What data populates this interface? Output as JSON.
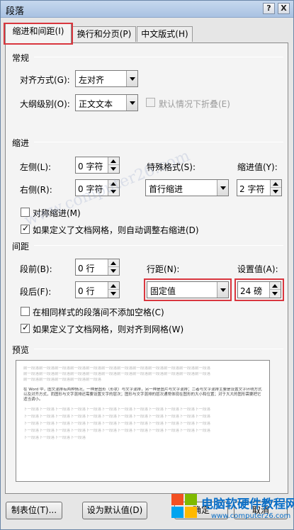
{
  "window": {
    "title": "段落"
  },
  "titlebar": {
    "help": "?",
    "close": "X"
  },
  "tabs": [
    {
      "label": "缩进和间距(I)",
      "key": "I"
    },
    {
      "label": "换行和分页(P)",
      "key": "P"
    },
    {
      "label": "中文版式(H)",
      "key": "H"
    }
  ],
  "general": {
    "header": "常规",
    "alignment": {
      "label": "对齐方式(G):",
      "value": "左对齐"
    },
    "outline": {
      "label": "大纲级别(O):",
      "value": "正文文本"
    },
    "collapsed": {
      "label": "默认情况下折叠(E)",
      "checked": false,
      "disabled": true
    }
  },
  "indent": {
    "header": "缩进",
    "left": {
      "label": "左侧(L):",
      "value": "0 字符"
    },
    "right": {
      "label": "右侧(R):",
      "value": "0 字符"
    },
    "special": {
      "label": "特殊格式(S):",
      "value": "首行缩进"
    },
    "by": {
      "label": "缩进值(Y):",
      "value": "2 字符"
    },
    "mirror": {
      "label": "对称缩进(M)",
      "checked": false
    },
    "auto_adjust": {
      "label": "如果定义了文档网格，则自动调整右缩进(D)",
      "checked": true
    }
  },
  "spacing": {
    "header": "间距",
    "before": {
      "label": "段前(B):",
      "value": "0 行"
    },
    "after": {
      "label": "段后(F):",
      "value": "0 行"
    },
    "line_spacing": {
      "label": "行距(N):",
      "value": "固定值"
    },
    "at": {
      "label": "设置值(A):",
      "value": "24 磅"
    },
    "no_space_same_style": {
      "label": "在相同样式的段落间不添加空格(C)",
      "checked": false
    },
    "snap_grid": {
      "label": "如果定义了文档网格，则对齐到网格(W)",
      "checked": true
    }
  },
  "preview": {
    "header": "预览",
    "prev_lines": [
      "前一段落前一段落前一段落前一段落前一段落前一段落前一段落前一段落前一段落前一段落前一段落前一段落",
      "前一段落前一段落前一段落前一段落前一段落前一段落前一段落前一段落前一段落前一段落前一段落前一段落",
      "前一段落前一段落前一段落前一段落前一段落"
    ],
    "current_lines": [
      "在 Word 中，图文混排有两种情况，一种是图形（形状）与文字混排，另一种是图片与文字混排；二者与文字混排主要是设置文字环绕方式以及对齐方式，而图形与文字混排还需要设置文字的层次；图形与文字混排的层次通常体现在图形的大小和位置；对于大大的图形需要把它适当调小。"
    ],
    "next_lines": [
      "下一段落下一段落下一段落下一段落下一段落下一段落下一段落下一段落下一段落下一段落下一段落下一段落",
      "下一段落下一段落下一段落下一段落下一段落下一段落下一段落下一段落下一段落下一段落下一段落下一段落",
      "下一段落下一段落下一段落下一段落下一段落下一段落下一段落下一段落下一段落下一段落下一段落下一段落",
      "下一段落下一段落下一段落下一段落下一段落下一段落下一段落下一段落下一段落下一段落下一段落下一段落",
      "下一段落下一段落下一段落下一段落"
    ]
  },
  "buttons": {
    "tabs": "制表位(T)...",
    "default": "设为默认值(D)",
    "ok": "确定",
    "cancel": "取消"
  },
  "watermark": "www.computer26.com",
  "logo": {
    "name": "电脑软硬件教程网",
    "url": "www.computer26.com",
    "colors": [
      "#f25022",
      "#7fba00",
      "#00a4ef",
      "#ffb900"
    ]
  }
}
